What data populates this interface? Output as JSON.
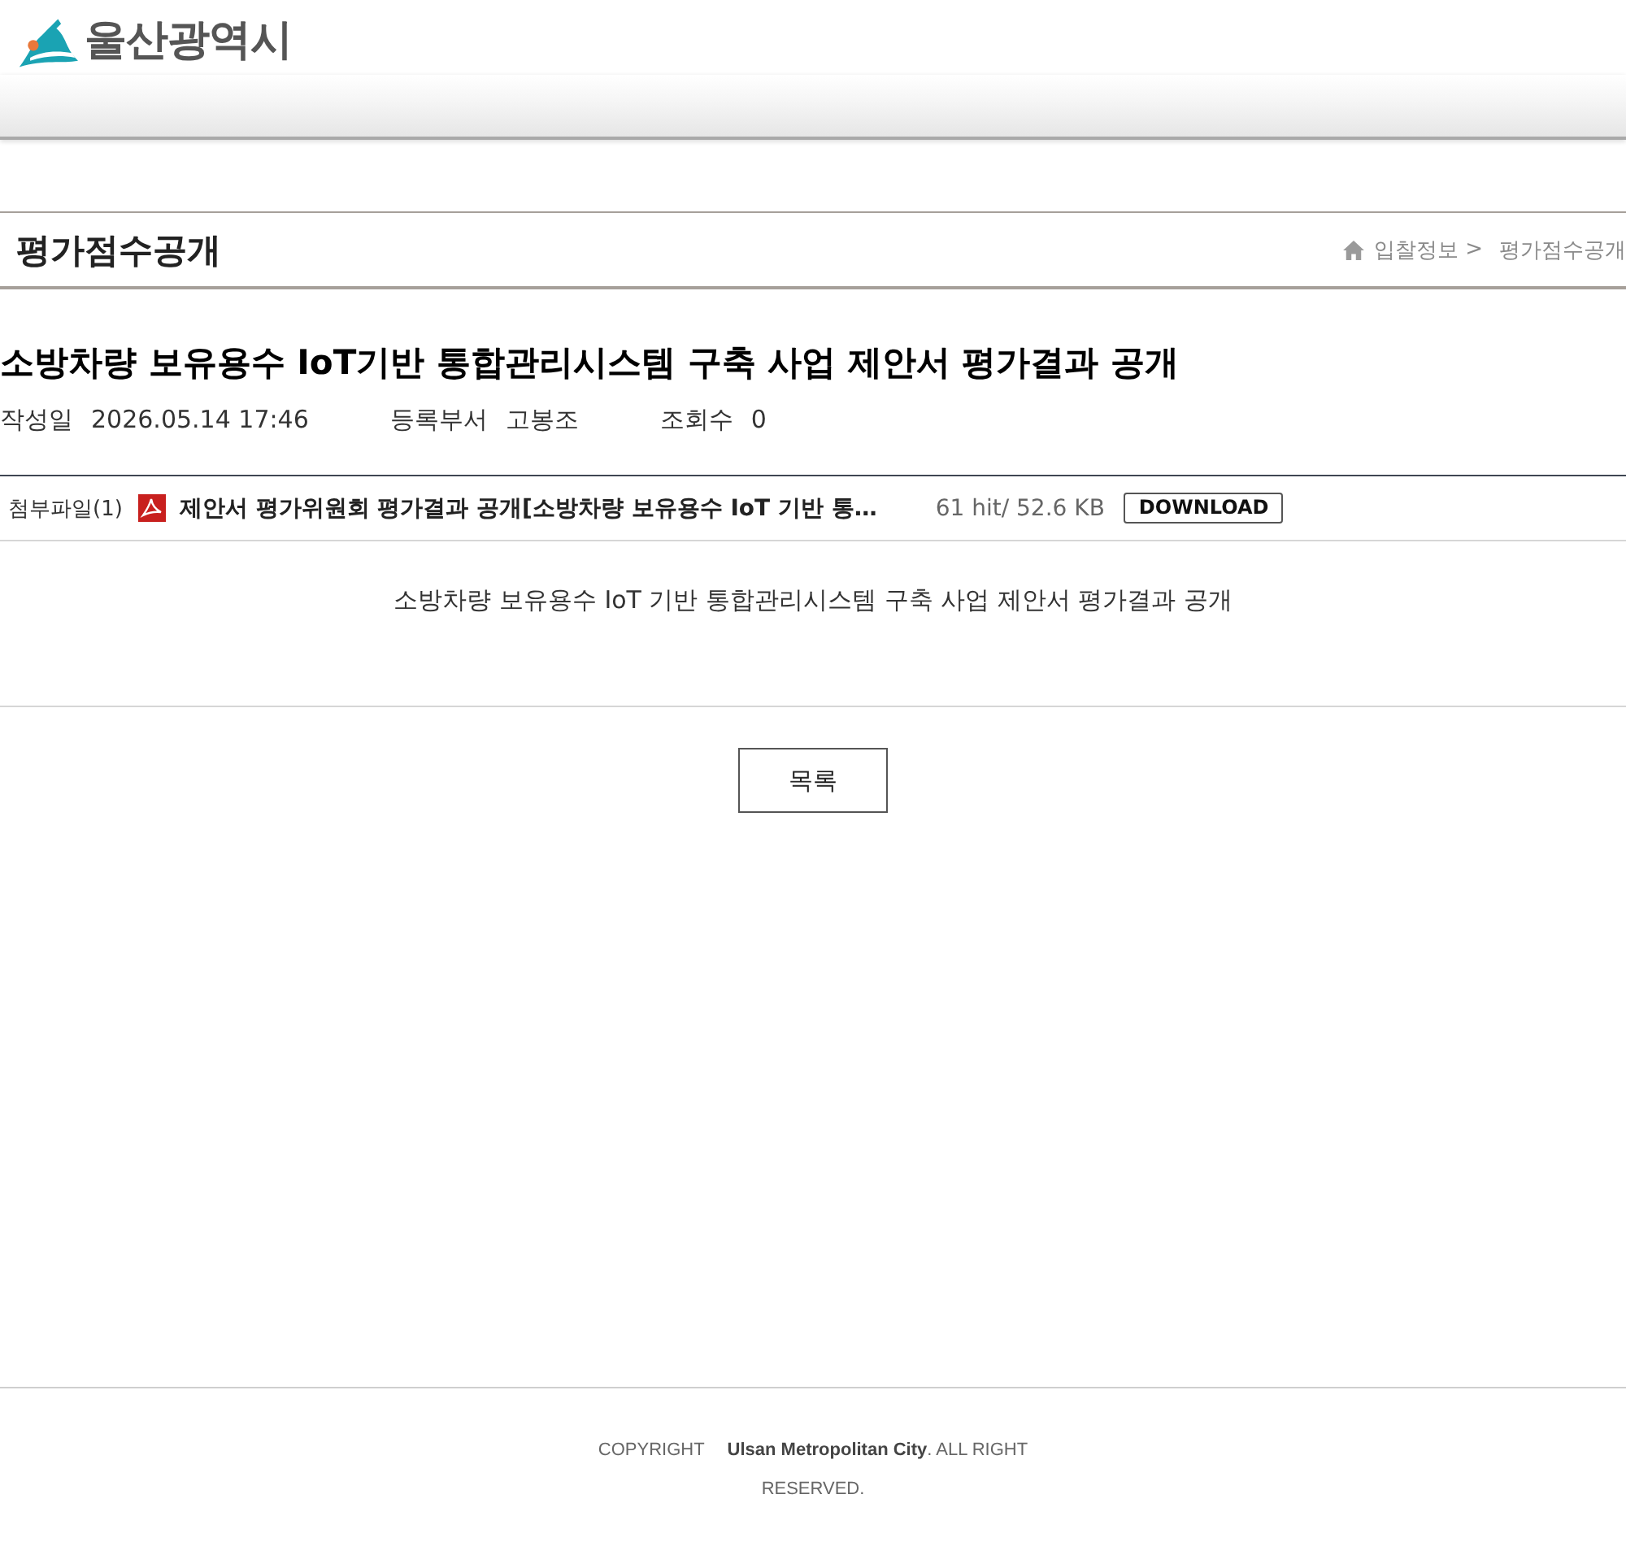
{
  "header": {
    "logo_text": "울산광역시"
  },
  "page_header": {
    "title": "평가점수공개",
    "breadcrumb": {
      "items": [
        "입찰정보",
        "평가점수공개"
      ],
      "separator": ">"
    }
  },
  "post": {
    "title": "소방차량 보유용수 IoT기반 통합관리시스템 구축 사업 제안서 평가결과 공개",
    "meta": [
      {
        "label": "작성일",
        "value": "2026.05.14 17:46"
      },
      {
        "label": "등록부서",
        "value": "고봉조"
      },
      {
        "label": "조회수",
        "value": "0"
      }
    ],
    "attachments": {
      "label": "첨부파일(1)",
      "files": [
        {
          "kind": "pdf",
          "name": "제안서 평가위원회 평가결과 공개[소방차량 보유용수 IoT 기반 통…",
          "stats": "61 hit/ 52.6 KB",
          "button": "DOWNLOAD"
        }
      ]
    },
    "body": "소방차량 보유용수 IoT 기반 통합관리시스템 구축 사업 제안서 평가결과 공개"
  },
  "list_button": "목록",
  "footer": {
    "copyright_label": "COPYRIGHT",
    "text": "**Ulsan Metropolitan City**. ALL RIGHT RESERVED."
  }
}
